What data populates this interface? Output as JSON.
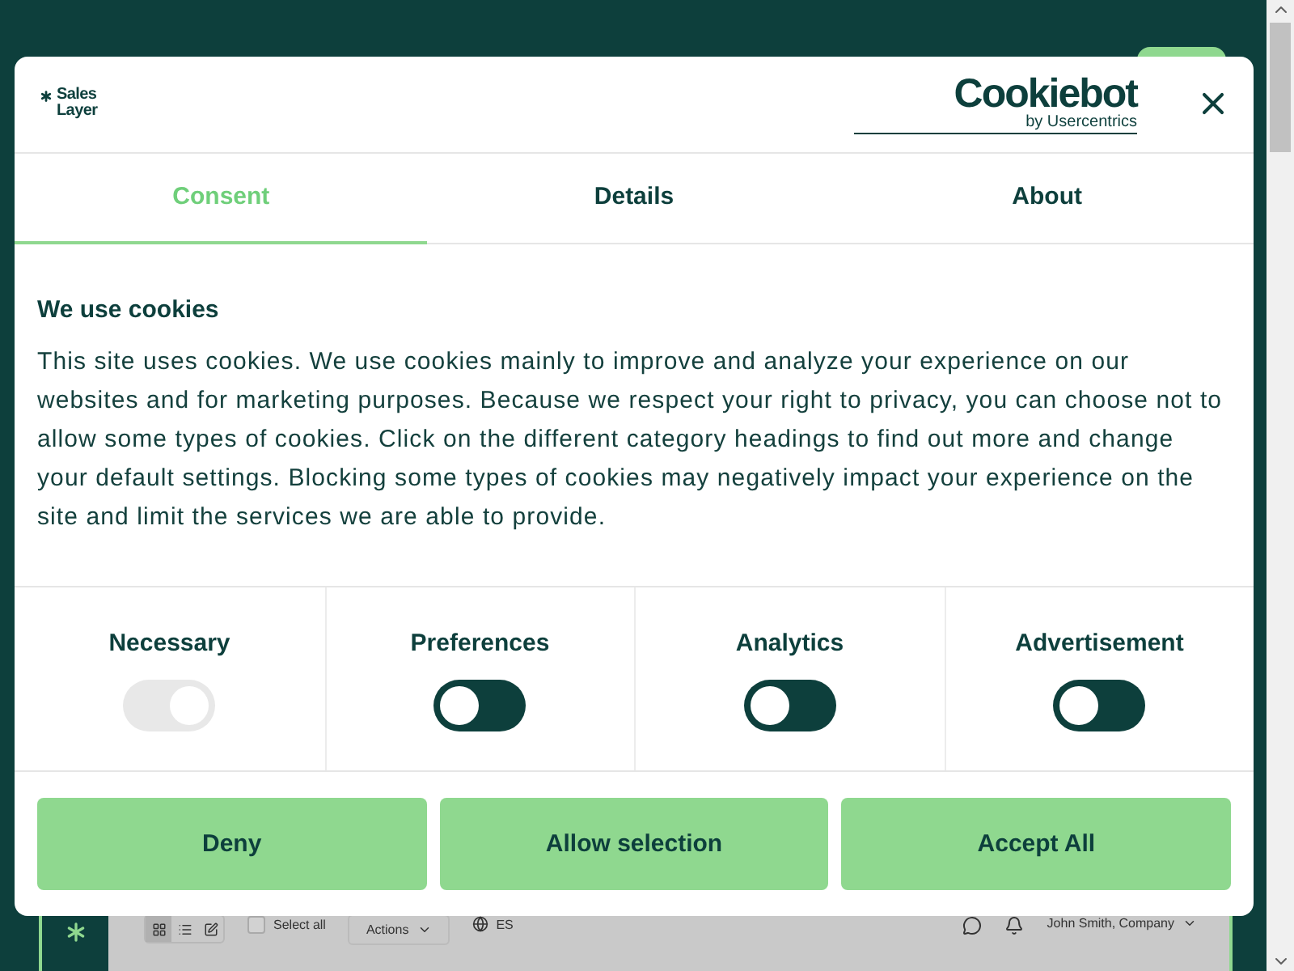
{
  "background_app": {
    "toolbar": {
      "view_modes": [
        {
          "kind": "grid",
          "selected": true
        },
        {
          "kind": "list",
          "selected": false
        },
        {
          "kind": "note",
          "selected": false
        }
      ],
      "select_all": {
        "label": "Select all",
        "checked": false
      },
      "actions": "Actions",
      "language": "ES",
      "user": "John Smith, Company"
    }
  },
  "dialog": {
    "logo": "Sales Layer",
    "provider": {
      "name": "Cookiebot",
      "byline": "by Usercentrics"
    },
    "tabs": [
      {
        "label": "Consent",
        "selected": true
      },
      {
        "label": "Details",
        "selected": false
      },
      {
        "label": "About",
        "selected": false
      }
    ],
    "heading": "We use cookies",
    "body": "This site uses cookies. We use cookies mainly to improve and analyze your experience on our websites and for marketing purposes. Because we respect your right to privacy, you can choose not to allow some types of cookies. Click on the different category headings to find out more and change your default settings. Blocking some types of cookies may negatively impact your experience on the site and limit the services we are able to provide.",
    "categories": [
      {
        "label": "Necessary",
        "on": true,
        "disabled": true
      },
      {
        "label": "Preferences",
        "on": false,
        "disabled": false
      },
      {
        "label": "Analytics",
        "on": false,
        "disabled": false
      },
      {
        "label": "Advertisement",
        "on": false,
        "disabled": false
      }
    ],
    "buttons": [
      "Deny",
      "Allow selection",
      "Accept All"
    ]
  }
}
